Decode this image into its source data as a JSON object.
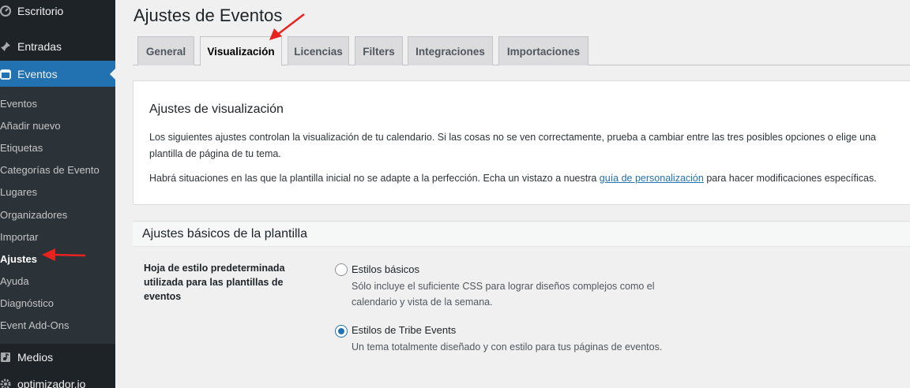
{
  "sidebar": {
    "top_items": [
      {
        "label": "Escritorio",
        "icon": "dashboard-icon"
      },
      {
        "label": "Entradas",
        "icon": "pin-icon"
      },
      {
        "label": "Eventos",
        "icon": "calendar-icon"
      }
    ],
    "submenu": [
      "Eventos",
      "Añadir nuevo",
      "Etiquetas",
      "Categorías de Evento",
      "Lugares",
      "Organizadores",
      "Importar",
      "Ajustes",
      "Ayuda",
      "Diagnóstico",
      "Event Add-Ons"
    ],
    "bottom_items": [
      {
        "label": "Medios",
        "icon": "media-icon"
      },
      {
        "label": "optimizador.io",
        "icon": "gear-icon"
      }
    ]
  },
  "page": {
    "title": "Ajustes de Eventos",
    "tabs": [
      "General",
      "Visualización",
      "Licencias",
      "Filters",
      "Integraciones",
      "Importaciones"
    ],
    "active_tab": "Visualización"
  },
  "intro": {
    "title": "Ajustes de visualización",
    "p1": "Los siguientes ajustes controlan la visualización de tu calendario. Si las cosas no se ven correctamente, prueba a cambiar entre las tres posibles opciones o elige una plantilla de página de tu tema.",
    "p2_before": "Habrá situaciones en las que la plantilla inicial no se adapte a la perfección. Echa un vistazo a nuestra ",
    "p2_link": "guía de personalización",
    "p2_after": " para hacer modificaciones específicas."
  },
  "section": {
    "title": "Ajustes básicos de la plantilla",
    "field_label": "Hoja de estilo predeterminada utilizada para las plantillas de eventos",
    "options": [
      {
        "label": "Estilos básicos",
        "description": "Sólo incluye el suficiente CSS para lograr diseños complejos como el calendario y vista de la semana.",
        "checked": false
      },
      {
        "label": "Estilos de Tribe Events",
        "description": "Un tema totalmente diseñado y con estilo para tus páginas de eventos.",
        "checked": true
      }
    ]
  },
  "colors": {
    "accent": "#2271b1",
    "sidebar_bg": "#1d2327",
    "submenu_bg": "#2c3338",
    "arrow": "#e8231f"
  }
}
